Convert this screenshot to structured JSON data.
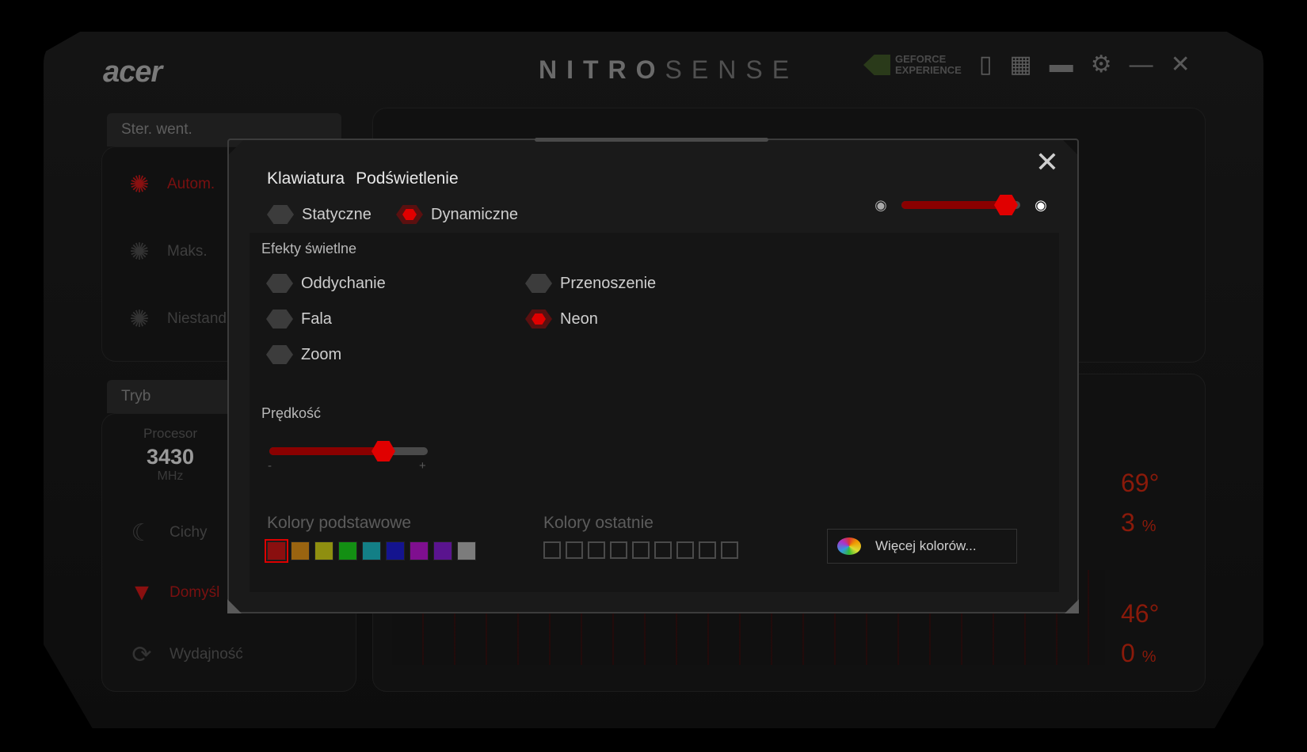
{
  "app": {
    "brand": "acer",
    "title_bold": "NITRO",
    "title_light": "SENSE",
    "geforce_line1": "GEFORCE",
    "geforce_line2": "EXPERIENCE"
  },
  "background": {
    "fan_tab": "Ster. went.",
    "fan_items": [
      "Autom.",
      "Maks.",
      "Niestand"
    ],
    "mode_tab": "Tryb",
    "cpu_label": "Procesor",
    "cpu_value": "3430",
    "cpu_unit": "MHz",
    "mode_items": [
      "Cichy",
      "Domyśl",
      "Wydajność"
    ],
    "temp1": "69°",
    "load1": "3",
    "temp2": "46°",
    "load2": "0",
    "percent": "%"
  },
  "modal": {
    "title_part1": "Klawiatura",
    "title_part2": "Podświetlenie",
    "mode_static": "Statyczne",
    "mode_dynamic": "Dynamiczne",
    "selected_mode": "Dynamiczne",
    "brightness": 0.88,
    "effects_title": "Efekty świetlne",
    "effects": {
      "breathing": "Oddychanie",
      "wave": "Fala",
      "zoom": "Zoom",
      "transfer": "Przenoszenie",
      "neon": "Neon"
    },
    "selected_effect": "Neon",
    "speed_title": "Prędkość",
    "speed": 0.72,
    "speed_min": "-",
    "speed_max": "+",
    "basic_colors_title": "Kolory podstawowe",
    "basic_colors": [
      "#8a0f0f",
      "#9a6410",
      "#8f8f10",
      "#138f13",
      "#137f86",
      "#14148f",
      "#7f0f8f",
      "#5a148f",
      "#7c7c7c"
    ],
    "recent_colors_title": "Kolory ostatnie",
    "recent_count": 9,
    "more_colors": "Więcej kolorów..."
  }
}
